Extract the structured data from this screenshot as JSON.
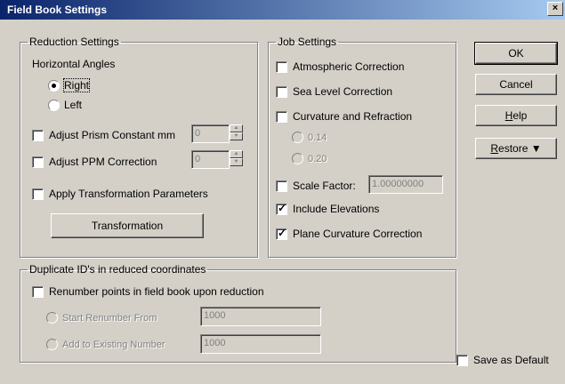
{
  "window": {
    "title": "Field Book Settings",
    "close_glyph": "×"
  },
  "reduction": {
    "legend": "Reduction Settings",
    "horizontal_angles_label": "Horizontal Angles",
    "right_label": "Right",
    "left_label": "Left",
    "prism_label": "Adjust Prism Constant mm",
    "prism_value": "0",
    "ppm_label": "Adjust PPM Correction",
    "ppm_value": "0",
    "transform_params_label": "Apply Transformation Parameters",
    "transformation_button": "Transformation"
  },
  "job": {
    "legend": "Job Settings",
    "atmospheric_label": "Atmospheric Correction",
    "sea_level_label": "Sea Level Correction",
    "curvature_label": "Curvature and Refraction",
    "coef_014": "0.14",
    "coef_020": "0.20",
    "scale_factor_label": "Scale Factor:",
    "scale_factor_value": "1.00000000",
    "include_elevations_label": "Include Elevations",
    "plane_curvature_label": "Plane Curvature Correction"
  },
  "duplicates": {
    "legend": "Duplicate ID's in reduced coordinates",
    "renumber_label": "Renumber points in field book upon reduction",
    "start_renumber_label": "Start Renumber From",
    "start_renumber_value": "1000",
    "add_existing_label": "Add to Existing Number",
    "add_existing_value": "1000"
  },
  "buttons": {
    "ok": "OK",
    "cancel": "Cancel",
    "help_first": "H",
    "help_rest": "elp",
    "restore_first": "R",
    "restore_rest": "estore ▼"
  },
  "save_default_label": "Save as Default"
}
